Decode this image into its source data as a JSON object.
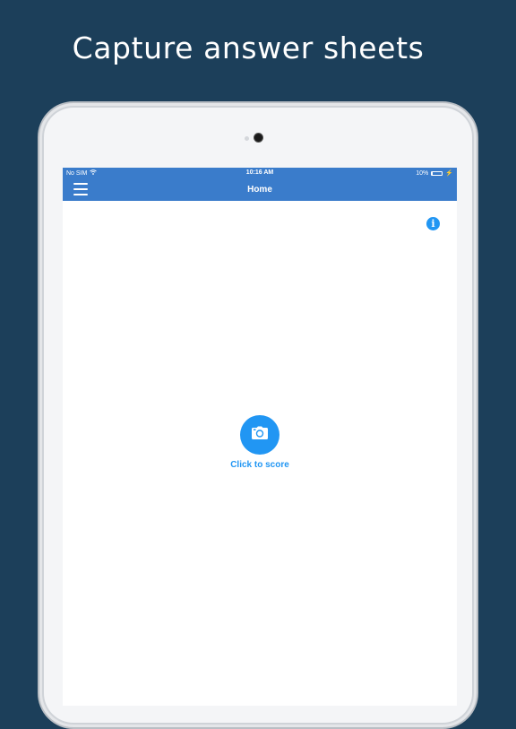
{
  "headline": "Capture answer sheets",
  "status_bar": {
    "carrier": "No SIM",
    "time": "10:16 AM",
    "battery_text": "10%",
    "battery_level": 0.1
  },
  "app_bar": {
    "title": "Home",
    "menu_icon": "hamburger-menu-icon",
    "color": "#3a7ccb"
  },
  "info": {
    "icon": "info-icon",
    "glyph": "i"
  },
  "score_action": {
    "icon": "camera-icon",
    "label": "Click to score",
    "accent": "#2196f3"
  }
}
